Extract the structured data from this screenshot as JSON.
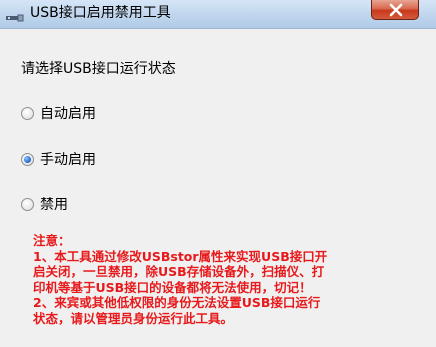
{
  "window": {
    "title": "USB接口启用禁用工具",
    "close_symbol": "close-icon"
  },
  "prompt": "请选择USB接口运行状态",
  "options": [
    {
      "label": "自动启用",
      "checked": false
    },
    {
      "label": "手动启用",
      "checked": true
    },
    {
      "label": "禁用",
      "checked": false
    }
  ],
  "notice": {
    "heading": "注意：",
    "lines": [
      "1、本工具通过修改USBstor属性来实现USB接口开",
      "启关闭，一旦禁用，除USB存储设备外，扫描仪、打",
      "印机等基于USB接口的设备都将无法使用，切记！",
      "2、来宾或其他低权限的身份无法设置USB接口运行",
      "状态，请以管理员身份运行此工具。"
    ],
    "color": "#e8191b"
  }
}
